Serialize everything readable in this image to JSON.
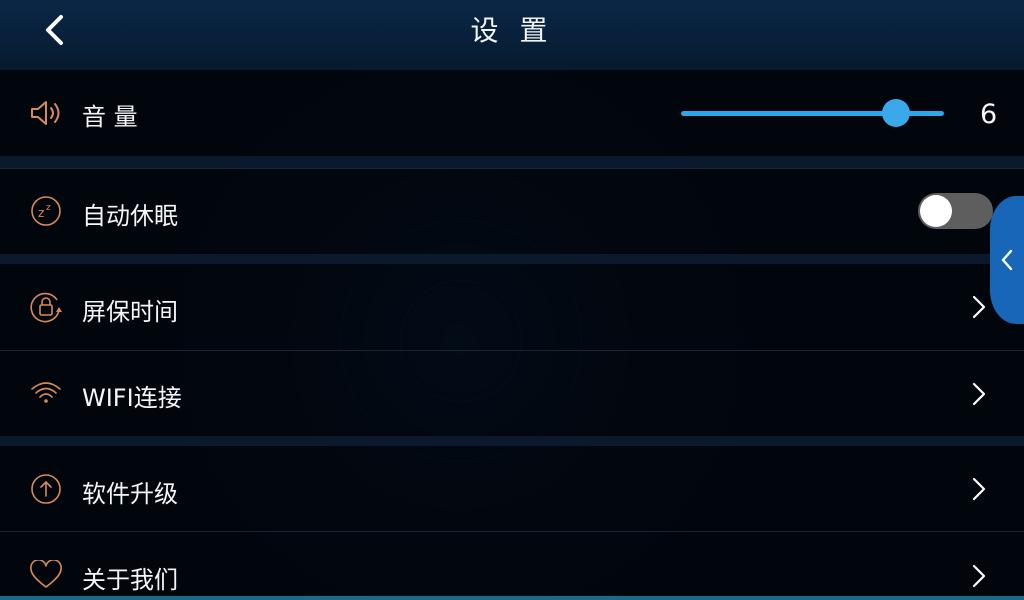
{
  "header": {
    "title": "设 置",
    "back_icon": "chevron-left-icon"
  },
  "volume": {
    "label": "音 量",
    "value": "6",
    "icon": "speaker-icon",
    "level": 0.82
  },
  "sleep": {
    "label": "自动休眠",
    "icon": "sleep-zz-icon",
    "enabled": false
  },
  "menu": [
    {
      "label": "屏保时间",
      "icon": "lock-timer-icon"
    },
    {
      "label": "WIFI连接",
      "icon": "wifi-icon"
    },
    {
      "label": "软件升级",
      "icon": "upgrade-arrow-icon"
    },
    {
      "label": "关于我们",
      "icon": "heart-icon"
    }
  ],
  "side_tab": {
    "icon": "chevron-left-icon"
  },
  "colors": {
    "accent_orange": "#d9895a",
    "slider_blue": "#2aa8ea",
    "side_tab_blue": "#1766b8",
    "toggle_off": "#5e5e5e",
    "header": "#0a2746"
  }
}
